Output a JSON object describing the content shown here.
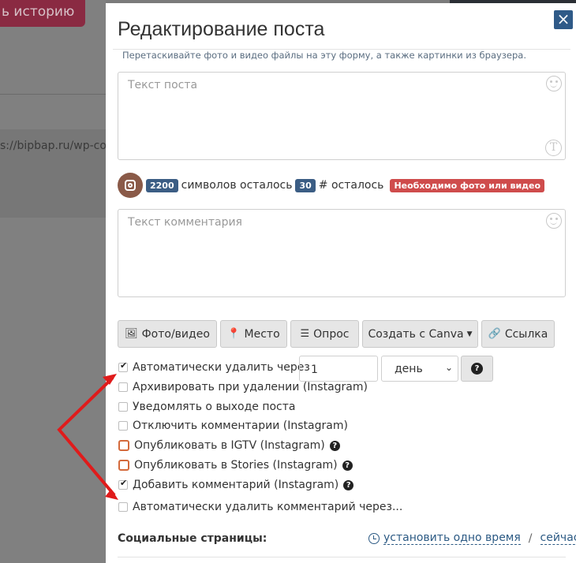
{
  "background": {
    "story_button": "ь историю",
    "url_fragment": "s://bipbap.ru/wp-co"
  },
  "modal": {
    "title": "Редактирование поста",
    "hint": "Перетаскивайте фото и видео файлы на эту форму, а также картинки из браузера.",
    "close": "×",
    "post_placeholder": "Текст поста",
    "comment_placeholder": "Текст комментария",
    "counters": {
      "chars_count": "2200",
      "chars_text": "символов осталось",
      "hash_count": "30",
      "hash_text": "# осталось",
      "warning": "Необходимо фото или видео"
    },
    "buttons": {
      "photo": "Фото/видео",
      "place": "Место",
      "poll": "Опрос",
      "canva": "Создать с Canva",
      "link": "Ссылка"
    },
    "options": {
      "auto_delete": "Автоматически удалить через",
      "auto_delete_value": "1",
      "auto_delete_unit": "день",
      "archive": "Архивировать при удалении (Instagram)",
      "notify": "Уведомлять о выходе поста",
      "disable_comments": "Отключить комментарии (Instagram)",
      "igtv": "Опубликовать в IGTV (Instagram)",
      "stories": "Опубликовать в Stories (Instagram)",
      "add_comment": "Добавить комментарий (Instagram)",
      "auto_delete_comment": "Автоматически удалить комментарий через..."
    },
    "social": {
      "label": "Социальные страницы:",
      "set_time": "установить одно время",
      "separator": "/",
      "now": "сейчас"
    }
  },
  "colors": {
    "accent": "#3b5d84",
    "warning": "#cf4c4c",
    "arrow": "#e01b1b"
  }
}
